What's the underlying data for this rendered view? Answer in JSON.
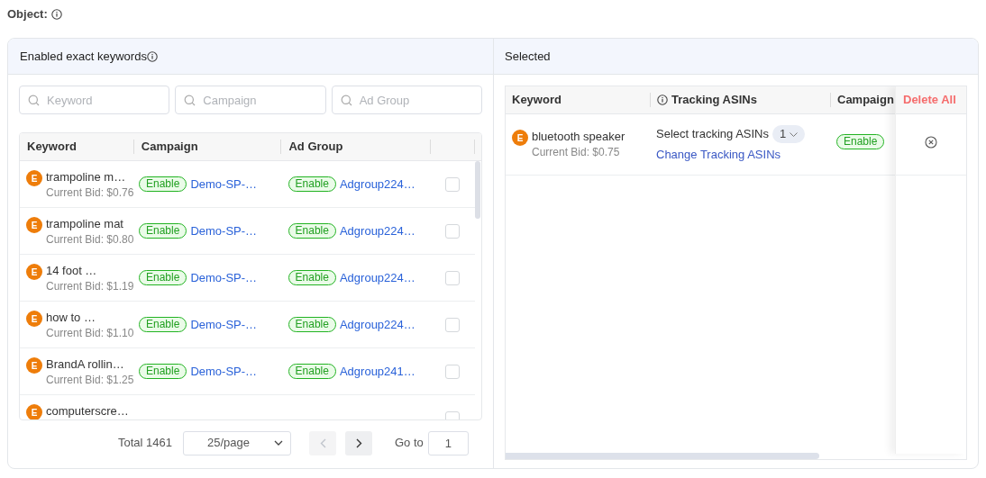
{
  "object_label": "Object:",
  "left_panel": {
    "title": "Enabled exact keywords",
    "search_fields": [
      {
        "placeholder": "Keyword"
      },
      {
        "placeholder": "Campaign"
      },
      {
        "placeholder": "Ad Group"
      }
    ],
    "table": {
      "columns": [
        "Keyword",
        "Campaign",
        "Ad Group"
      ],
      "rows": [
        {
          "badge": "E",
          "keyword": "trampoline m…",
          "bid": "Current Bid: $0.76",
          "campaign_status": "Enable",
          "campaign": "Demo-SP-…",
          "ad_group_status": "Enable",
          "ad_group": "Adgroup224…",
          "checked": false
        },
        {
          "badge": "E",
          "keyword": "trampoline mat",
          "bid": "Current Bid: $0.80",
          "campaign_status": "Enable",
          "campaign": "Demo-SP-…",
          "ad_group_status": "Enable",
          "ad_group": "Adgroup224…",
          "checked": false
        },
        {
          "badge": "E",
          "keyword": "14 foot …",
          "bid": "Current Bid: $1.19",
          "campaign_status": "Enable",
          "campaign": "Demo-SP-…",
          "ad_group_status": "Enable",
          "ad_group": "Adgroup224…",
          "checked": false
        },
        {
          "badge": "E",
          "keyword": "how to …",
          "bid": "Current Bid: $1.10",
          "campaign_status": "Enable",
          "campaign": "Demo-SP-…",
          "ad_group_status": "Enable",
          "ad_group": "Adgroup224…",
          "checked": false
        },
        {
          "badge": "E",
          "keyword": "BrandA rollin…",
          "bid": "Current Bid: $1.25",
          "campaign_status": "Enable",
          "campaign": "Demo-SP-…",
          "ad_group_status": "Enable",
          "ad_group": "Adgroup241…",
          "checked": false
        },
        {
          "badge": "E",
          "keyword": "computerscre…",
          "checked": false
        }
      ]
    },
    "pagination": {
      "total": "Total 1461",
      "page_size": "25/page",
      "prev": {
        "disabled": true
      },
      "next": {
        "disabled": false
      },
      "goto_label": "Go to",
      "page": "1"
    }
  },
  "right_panel": {
    "title": "Selected",
    "table": {
      "columns": [
        {
          "label": "Keyword"
        },
        {
          "label": "Tracking ASINs",
          "info": true
        },
        {
          "label": "Campaign"
        }
      ],
      "action_label": "Delete All",
      "rows": [
        {
          "badge": "E",
          "keyword": "bluetooth speaker",
          "bid": "Current Bid: $0.75",
          "tracking_label": "Select tracking ASINs",
          "tracking_count": "1",
          "change_link": "Change Tracking ASINs",
          "campaign_status": "Enable"
        }
      ]
    }
  }
}
